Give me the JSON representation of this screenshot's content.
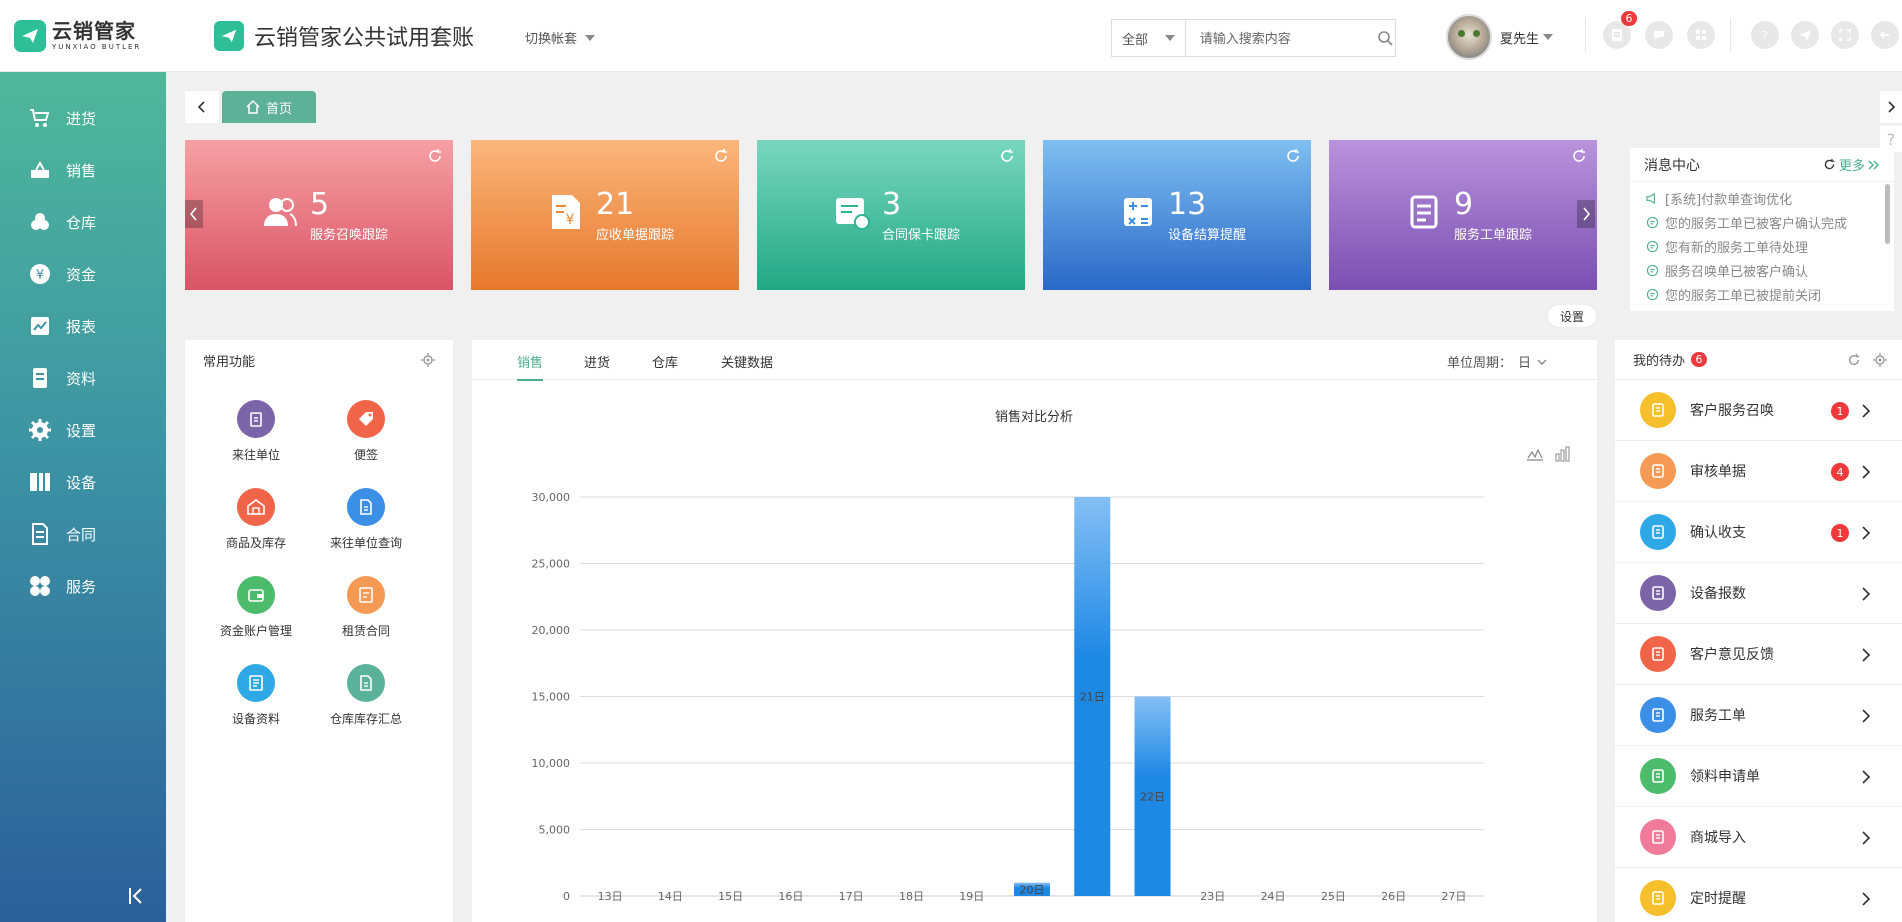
{
  "brand": {
    "name_cn": "云销管家",
    "name_en": "YUNXIAO BUTLER",
    "accent": "#2fbf96"
  },
  "header": {
    "title": "云销管家公共试用套账",
    "switch_account": "切换帐套",
    "search": {
      "scope": "全部",
      "placeholder": "请输入搜索内容"
    },
    "user": {
      "name": "夏先生"
    },
    "notice_count": "6"
  },
  "sidebar": {
    "items": [
      {
        "label": "进货",
        "icon": "cart-icon"
      },
      {
        "label": "销售",
        "icon": "sale-icon"
      },
      {
        "label": "仓库",
        "icon": "warehouse-icon"
      },
      {
        "label": "资金",
        "icon": "yen-icon"
      },
      {
        "label": "报表",
        "icon": "report-icon"
      },
      {
        "label": "资料",
        "icon": "document-icon"
      },
      {
        "label": "设置",
        "icon": "gear-icon"
      },
      {
        "label": "设备",
        "icon": "device-icon"
      },
      {
        "label": "合同",
        "icon": "contract-icon"
      },
      {
        "label": "服务",
        "icon": "service-icon"
      }
    ]
  },
  "tabs": {
    "home": "首页"
  },
  "cards": [
    {
      "value": "5",
      "label": "服务召唤跟踪",
      "color": "#e8707d"
    },
    {
      "value": "21",
      "label": "应收单据跟踪",
      "color": "#f2954a"
    },
    {
      "value": "3",
      "label": "合同保卡跟踪",
      "color": "#3dc0a3"
    },
    {
      "value": "13",
      "label": "设备结算提醒",
      "color": "#3d8ee0"
    },
    {
      "value": "9",
      "label": "服务工单跟踪",
      "color": "#8a62bf"
    }
  ],
  "messages": {
    "title": "消息中心",
    "more": "更多",
    "items": [
      "[系统]付款单查询优化",
      "您的服务工单已被客户确认完成",
      "您有新的服务工单待处理",
      "服务召唤单已被客户确认",
      "您的服务工单已被提前关闭"
    ],
    "settings": "设置"
  },
  "functions": {
    "title": "常用功能",
    "items": [
      {
        "label": "来往单位",
        "color": "#7b64a8",
        "icon": "clipboard-icon"
      },
      {
        "label": "便签",
        "color": "#f0644a",
        "icon": "tag-icon"
      },
      {
        "label": "商品及库存",
        "color": "#f0644a",
        "icon": "store-icon"
      },
      {
        "label": "来往单位查询",
        "color": "#3b8fe6",
        "icon": "file-search-icon"
      },
      {
        "label": "资金账户管理",
        "color": "#4cbb6c",
        "icon": "wallet-icon"
      },
      {
        "label": "租赁合同",
        "color": "#f59a55",
        "icon": "lease-icon"
      },
      {
        "label": "设备资料",
        "color": "#2fa8e6",
        "icon": "device-doc-icon"
      },
      {
        "label": "仓库库存汇总",
        "color": "#5bb29a",
        "icon": "inventory-icon"
      }
    ]
  },
  "chart_tabs": [
    "销售",
    "进货",
    "仓库",
    "关键数据"
  ],
  "unit_period": {
    "label": "单位周期：",
    "value": "日"
  },
  "chart_data": {
    "type": "bar",
    "title": "销售对比分析",
    "categories": [
      "13日",
      "14日",
      "15日",
      "16日",
      "17日",
      "18日",
      "19日",
      "20日",
      "21日",
      "22日",
      "23日",
      "24日",
      "25日",
      "26日",
      "27日"
    ],
    "values": [
      0,
      0,
      0,
      0,
      0,
      0,
      0,
      1000,
      30000,
      15000,
      0,
      0,
      0,
      0,
      0
    ],
    "ylim": [
      0,
      30000
    ],
    "yticks": [
      "0",
      "5,000",
      "10,000",
      "15,000",
      "20,000",
      "25,000",
      "30,000"
    ],
    "grid": true,
    "color": "#1e88e5"
  },
  "todo": {
    "title": "我的待办",
    "count": "6",
    "items": [
      {
        "label": "客户服务召唤",
        "badge": "1",
        "color": "#f6c02d",
        "icon": "users-icon"
      },
      {
        "label": "审核单据",
        "badge": "4",
        "color": "#f59a55",
        "icon": "audit-icon"
      },
      {
        "label": "确认收支",
        "badge": "1",
        "color": "#2fa8e6",
        "icon": "confirm-icon"
      },
      {
        "label": "设备报数",
        "badge": "",
        "color": "#7b64a8",
        "icon": "meter-icon"
      },
      {
        "label": "客户意见反馈",
        "badge": "",
        "color": "#f0644a",
        "icon": "feedback-icon"
      },
      {
        "label": "服务工单",
        "badge": "",
        "color": "#3b8fe6",
        "icon": "workorder-icon"
      },
      {
        "label": "领料申请单",
        "badge": "",
        "color": "#4cbb6c",
        "icon": "material-icon"
      },
      {
        "label": "商城导入",
        "badge": "",
        "color": "#f07a9a",
        "icon": "import-icon"
      },
      {
        "label": "定时提醒",
        "badge": "",
        "color": "#f6c02d",
        "icon": "timer-icon"
      }
    ]
  }
}
